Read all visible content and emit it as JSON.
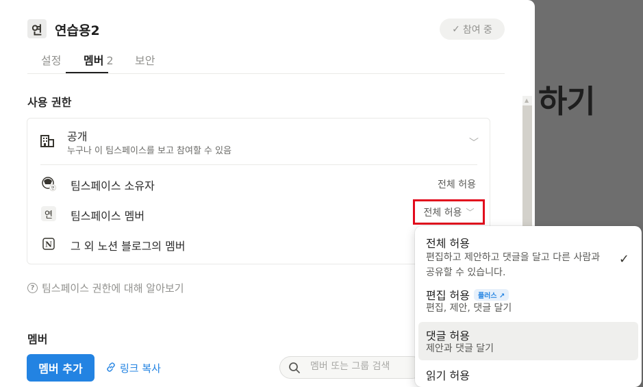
{
  "background": {
    "title": "하기"
  },
  "header": {
    "workspace_icon": "연",
    "workspace_name": "연습용2",
    "joined_label": "참여 중"
  },
  "tabs": [
    {
      "label": "설정"
    },
    {
      "label": "멤버",
      "count": "2"
    },
    {
      "label": "보안"
    }
  ],
  "access": {
    "section_title": "사용 권한",
    "head_title": "공개",
    "head_desc": "누구나 이 팀스페이스를 보고 참여할 수 있음",
    "rows": [
      {
        "label": "팀스페이스 소유자",
        "value": "전체 허용",
        "icon": "owner-avatar-icon"
      },
      {
        "label": "팀스페이스 멤버",
        "value": "전체 허용",
        "icon": "연"
      },
      {
        "label": "그 외 노션 블로그의 멤버",
        "icon": "notion-logo-icon"
      }
    ],
    "learn_more": "팀스페이스 권한에 대해 알아보기"
  },
  "members": {
    "section_title": "멤버",
    "add_button": "멤버 추가",
    "copy_link": "링크 복사",
    "search_placeholder": "멤버 또는 그룹 검색"
  },
  "dropdown": {
    "options": [
      {
        "title": "전체 허용",
        "desc1": "편집하고 제안하고 댓글을 달고 다른 사람과",
        "desc2": "공유할 수 있습니다.",
        "selected": true
      },
      {
        "title": "편집 허용",
        "badge": "플러스 ↗",
        "desc1": "편집, 제안, 댓글 달기"
      },
      {
        "title": "댓글 허용",
        "desc1": "제안과 댓글 달기",
        "hovered": true
      },
      {
        "title": "읽기 허용"
      }
    ]
  },
  "colors": {
    "accent": "#2383e2",
    "highlight": "#e2091c"
  }
}
